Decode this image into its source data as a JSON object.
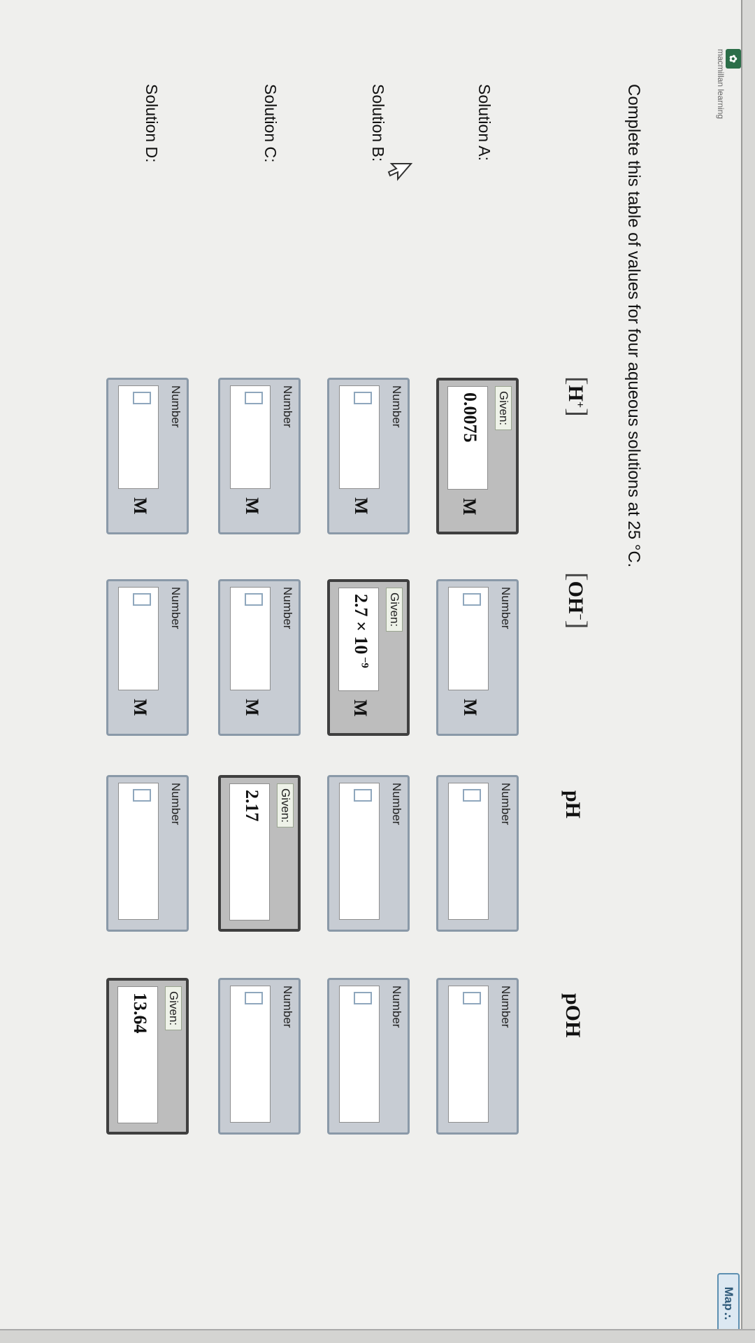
{
  "header": {
    "brand": "macmillan learning",
    "map_label": "Map"
  },
  "prompt": "Complete this table of values for four aqueous solutions at 25 °C.",
  "columns": [
    {
      "label": "H",
      "sup": "+"
    },
    {
      "label": "OH",
      "sup": "−"
    },
    {
      "label": "pH"
    },
    {
      "label": "pOH"
    }
  ],
  "labels": {
    "given": "Given:",
    "number": "Number",
    "unit": "M"
  },
  "rows": [
    {
      "name": "Solution A:",
      "h": {
        "given": true,
        "value": "0.0075"
      },
      "oh": {
        "given": false,
        "value": ""
      },
      "ph": {
        "given": false,
        "value": ""
      },
      "poh": {
        "given": false,
        "value": ""
      }
    },
    {
      "name": "Solution B:",
      "h": {
        "given": false,
        "value": ""
      },
      "oh": {
        "given": true,
        "value": "2.7 × 10",
        "exp": "−9"
      },
      "ph": {
        "given": false,
        "value": ""
      },
      "poh": {
        "given": false,
        "value": ""
      }
    },
    {
      "name": "Solution C:",
      "h": {
        "given": false,
        "value": ""
      },
      "oh": {
        "given": false,
        "value": ""
      },
      "ph": {
        "given": true,
        "value": "2.17"
      },
      "poh": {
        "given": false,
        "value": ""
      }
    },
    {
      "name": "Solution D:",
      "h": {
        "given": false,
        "value": ""
      },
      "oh": {
        "given": false,
        "value": ""
      },
      "ph": {
        "given": false,
        "value": ""
      },
      "poh": {
        "given": true,
        "value": "13.64"
      }
    }
  ]
}
